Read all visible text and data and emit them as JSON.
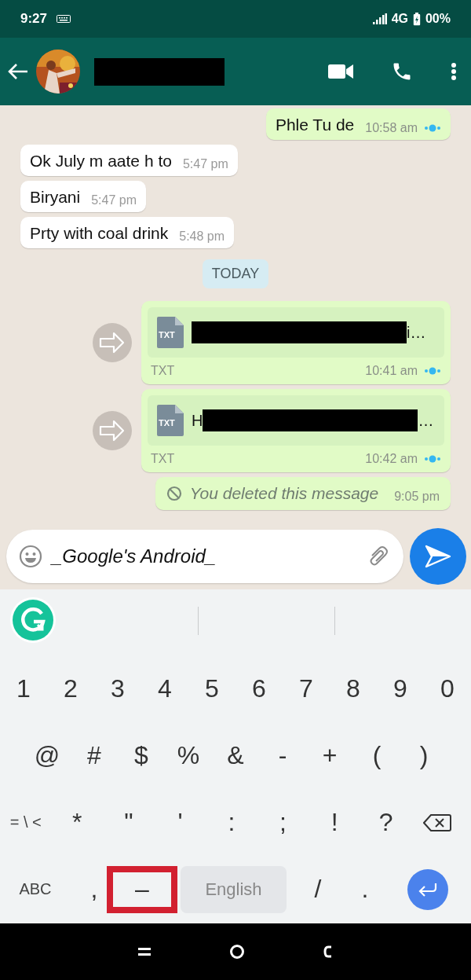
{
  "status_bar": {
    "time": "9:27",
    "network": "4G",
    "battery": "00%"
  },
  "messages": [
    {
      "kind": "outgoing_text",
      "text": "Phle Tu de",
      "time": "10:58 am",
      "read": true
    },
    {
      "kind": "incoming_text",
      "text": "Ok July m aate h to",
      "time": "5:47 pm"
    },
    {
      "kind": "incoming_text",
      "text": "Biryani",
      "time": "5:47 pm"
    },
    {
      "kind": "incoming_text",
      "text": "Prty with coal drink",
      "time": "5:48 pm"
    },
    {
      "kind": "date",
      "text": "TODAY"
    },
    {
      "kind": "file",
      "file_icon": "TXT",
      "name_after": "i…",
      "file_type": "TXT",
      "time": "10:41 am",
      "read": true
    },
    {
      "kind": "file",
      "file_icon": "TXT",
      "name_before": "H",
      "name_after": "…",
      "file_type": "TXT",
      "time": "10:42 am",
      "read": true
    },
    {
      "kind": "deleted",
      "text": "You deleted this message",
      "time": "9:05 pm"
    }
  ],
  "composer": {
    "value": "_Google's Android_"
  },
  "keyboard": {
    "rows": [
      {
        "keys": [
          {
            "kind": "char",
            "label": "1"
          },
          {
            "kind": "char",
            "label": "2"
          },
          {
            "kind": "char",
            "label": "3"
          },
          {
            "kind": "char",
            "label": "4"
          },
          {
            "kind": "char",
            "label": "5"
          },
          {
            "kind": "char",
            "label": "6"
          },
          {
            "kind": "char",
            "label": "7"
          },
          {
            "kind": "char",
            "label": "8"
          },
          {
            "kind": "char",
            "label": "9"
          },
          {
            "kind": "char",
            "label": "0"
          }
        ]
      },
      {
        "keys": [
          {
            "kind": "char",
            "label": "@"
          },
          {
            "kind": "char",
            "label": "#"
          },
          {
            "kind": "char",
            "label": "$"
          },
          {
            "kind": "char",
            "label": "%"
          },
          {
            "kind": "char",
            "label": "&"
          },
          {
            "kind": "char",
            "label": "-"
          },
          {
            "kind": "char",
            "label": "+"
          },
          {
            "kind": "char",
            "label": "("
          },
          {
            "kind": "char",
            "label": ")"
          }
        ]
      },
      {
        "keys": [
          {
            "kind": "small",
            "label": "= \\ <"
          },
          {
            "kind": "char",
            "label": "*"
          },
          {
            "kind": "char",
            "label": "\""
          },
          {
            "kind": "char",
            "label": "'"
          },
          {
            "kind": "char",
            "label": ":"
          },
          {
            "kind": "char",
            "label": ";"
          },
          {
            "kind": "char",
            "label": "!"
          },
          {
            "kind": "char",
            "label": "?"
          },
          {
            "kind": "backspace"
          }
        ]
      },
      {
        "keys": [
          {
            "kind": "small",
            "label": "ABC"
          },
          {
            "kind": "char",
            "label": ","
          },
          {
            "kind": "char",
            "label": "–",
            "highlighted": true
          },
          {
            "kind": "space",
            "label": "English"
          },
          {
            "kind": "char",
            "label": "/"
          },
          {
            "kind": "char",
            "label": "."
          },
          {
            "kind": "enter"
          }
        ]
      }
    ]
  }
}
